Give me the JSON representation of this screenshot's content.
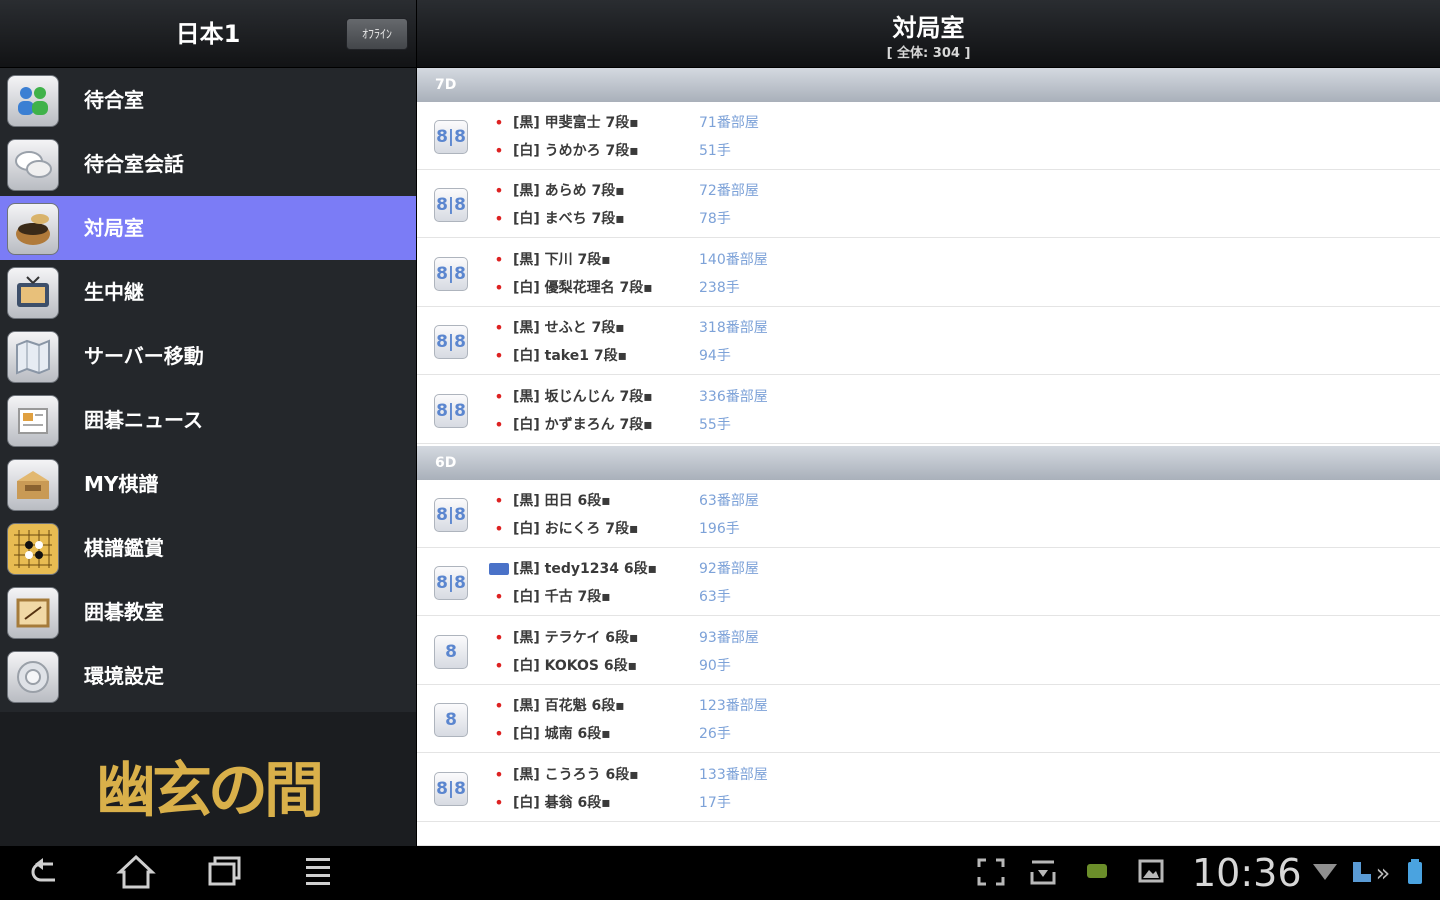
{
  "sidebar": {
    "title": "日本1",
    "header_button": "ｵﾌﾗｲﾝ",
    "items": [
      {
        "label": "待合室",
        "icon": "users-icon"
      },
      {
        "label": "待合室会話",
        "icon": "chat-icon"
      },
      {
        "label": "対局室",
        "icon": "go-bowl-icon",
        "active": true
      },
      {
        "label": "生中継",
        "icon": "tv-icon"
      },
      {
        "label": "サーバー移動",
        "icon": "map-icon"
      },
      {
        "label": "囲碁ニュース",
        "icon": "news-icon"
      },
      {
        "label": "MY棋譜",
        "icon": "record-box-icon"
      },
      {
        "label": "棋譜鑑賞",
        "icon": "go-board-icon"
      },
      {
        "label": "囲碁教室",
        "icon": "classroom-icon"
      },
      {
        "label": "環境設定",
        "icon": "settings-icon"
      }
    ],
    "logo_text": "幽玄の間"
  },
  "main": {
    "title": "対局室",
    "subtitle": "[ 全体: 304 ]",
    "groups": [
      {
        "label": "7D",
        "rows": [
          {
            "icon": "8|8",
            "black": "[黒] 甲斐富士 7段▪",
            "white": "[白] うめかろ 7段▪",
            "room": "71番部屋",
            "moves": "51手"
          },
          {
            "icon": "8|8",
            "black": "[黒] あらめ 7段▪",
            "white": "[白] まべち 7段▪",
            "room": "72番部屋",
            "moves": "78手"
          },
          {
            "icon": "8|8",
            "black": "[黒] 下川 7段▪",
            "white": "[白] 優梨花理名 7段▪",
            "room": "140番部屋",
            "moves": "238手"
          },
          {
            "icon": "8|8",
            "black": "[黒] せふと 7段▪",
            "white": "[白] take1 7段▪",
            "room": "318番部屋",
            "moves": "94手"
          },
          {
            "icon": "8|8",
            "black": "[黒] 坂じんじん 7段▪",
            "white": "[白] かずまろん 7段▪",
            "room": "336番部屋",
            "moves": "55手"
          }
        ]
      },
      {
        "label": "6D",
        "rows": [
          {
            "icon": "8|8",
            "black": "[黒] 田日 6段▪",
            "white": "[白] おにくろ 7段▪",
            "room": "63番部屋",
            "moves": "196手"
          },
          {
            "icon": "8|8",
            "black": "[黒] tedy1234 6段▪",
            "white": "[白] 千古 7段▪",
            "room": "92番部屋",
            "moves": "63手",
            "badge": true
          },
          {
            "icon": "8",
            "black": "[黒] テラケイ 6段▪",
            "white": "[白] KOKOS 6段▪",
            "room": "93番部屋",
            "moves": "90手"
          },
          {
            "icon": "8",
            "black": "[黒] 百花魁 6段▪",
            "white": "[白] 城南 6段▪",
            "room": "123番部屋",
            "moves": "26手"
          },
          {
            "icon": "8|8",
            "black": "[黒] こうろう 6段▪",
            "white": "[白] 碁翁 6段▪",
            "room": "133番部屋",
            "moves": "17手"
          }
        ]
      }
    ]
  },
  "navbar": {
    "clock": "10:36",
    "buttons": [
      "back-icon",
      "home-icon",
      "recent-apps-icon",
      "menu-icon"
    ],
    "tray": [
      "screenshot-icon",
      "download-icon",
      "android-icon",
      "gallery-icon",
      "wifi-icon",
      "usb-icon",
      "battery-icon"
    ]
  }
}
